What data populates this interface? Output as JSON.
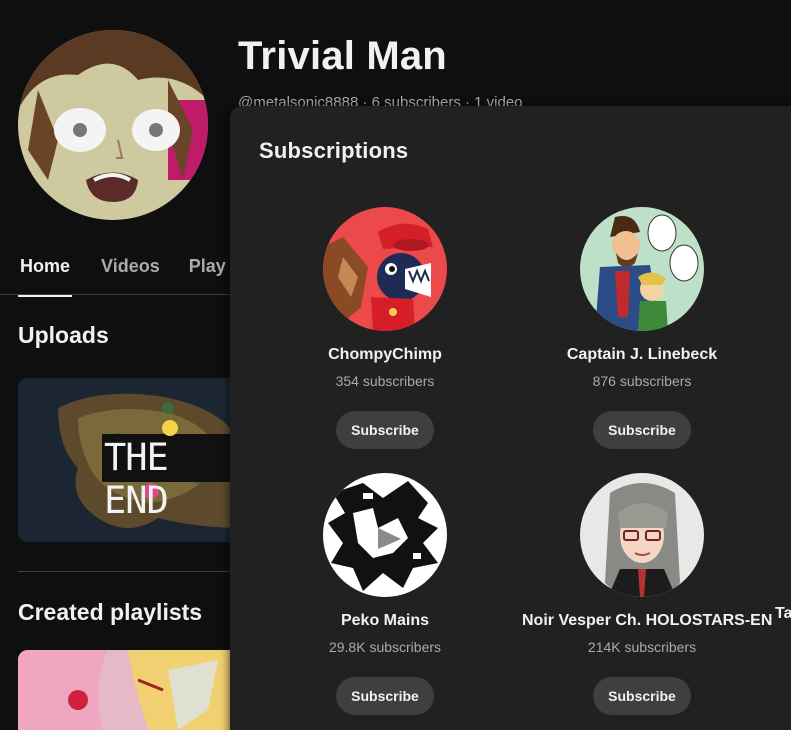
{
  "channel": {
    "name": "Trivial Man",
    "meta": "@metalsonic8888 · 6 subscribers · 1 video"
  },
  "tabs": [
    {
      "label": "Home",
      "active": true
    },
    {
      "label": "Videos",
      "active": false
    },
    {
      "label": "Play",
      "active": false
    }
  ],
  "sections": {
    "uploads": "Uploads",
    "playlists": "Created playlists"
  },
  "upload_thumbnail_text": "THE END",
  "subscriptions": {
    "title": "Subscriptions",
    "channels": [
      {
        "name": "ChompyChimp",
        "subscribers": "354 subscribers",
        "button": "Subscribe"
      },
      {
        "name": "Captain J. Linebeck",
        "subscribers": "876 subscribers",
        "button": "Subscribe"
      },
      {
        "name": "Peko Mains",
        "subscribers": "29.8K subscribers",
        "button": "Subscribe"
      },
      {
        "name": "Noir Vesper Ch. HOLOSTARS-EN",
        "subscribers": "214K subscribers",
        "button": "Subscribe"
      }
    ],
    "cut_off_name": "Ta"
  }
}
